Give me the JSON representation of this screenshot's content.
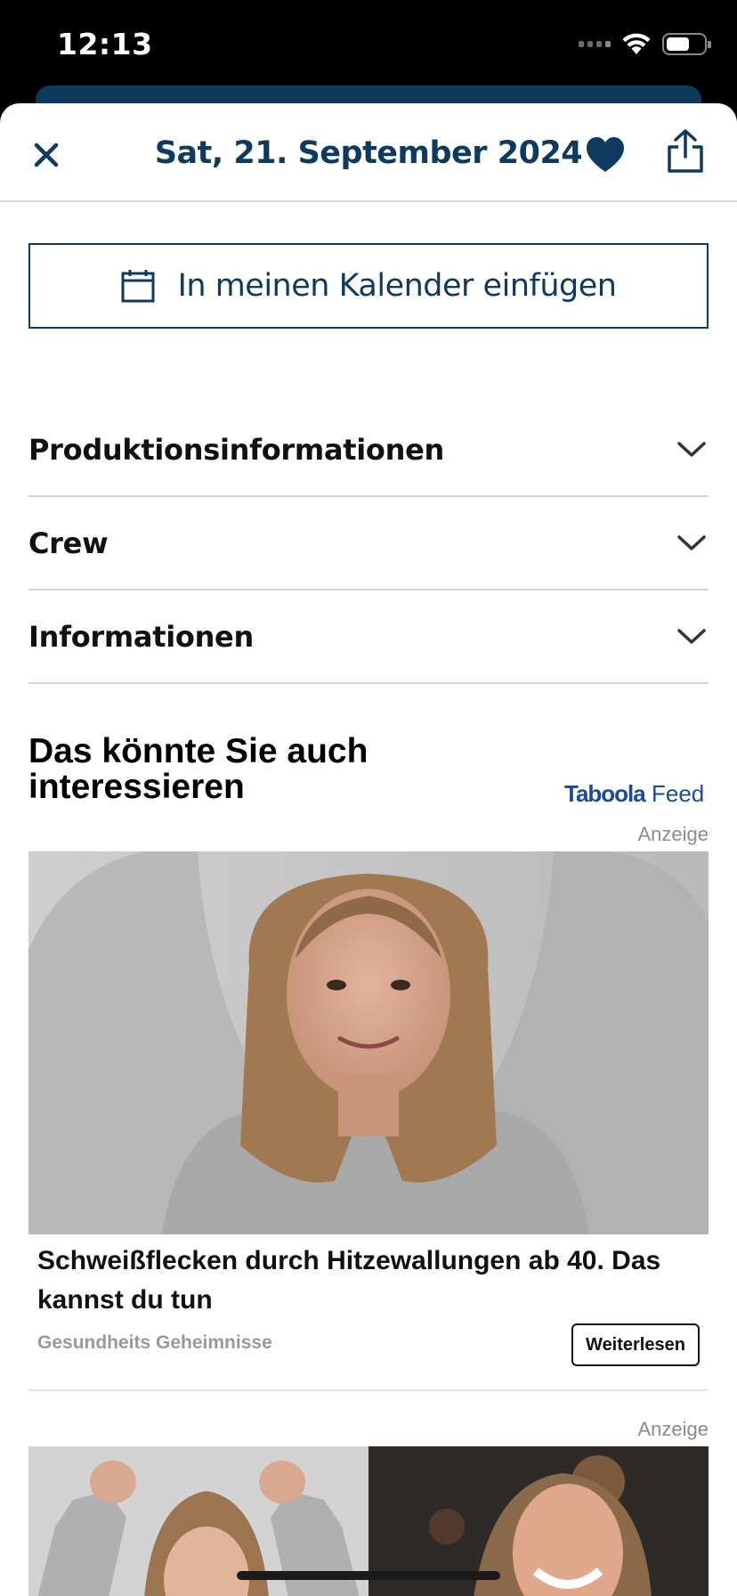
{
  "status": {
    "time": "12:13"
  },
  "header": {
    "title": "Sat, 21. September 2024"
  },
  "calendar_button": {
    "label": "In meinen Kalender einfügen"
  },
  "accordion": [
    {
      "label": "Produktionsinformationen"
    },
    {
      "label": "Crew"
    },
    {
      "label": "Informationen"
    }
  ],
  "recommendations": {
    "title": "Das könnte Sie auch interessieren",
    "provider_brand": "Taboola",
    "provider_suffix": "Feed",
    "sponsored_label": "Anzeige",
    "items": [
      {
        "title": "Schweißflecken durch Hitzewallungen ab 40. Das kannst du tun",
        "source": "Gesundheits Geheimnisse",
        "cta": "Weiterlesen"
      }
    ],
    "second_sponsored_label": "Anzeige"
  },
  "colors": {
    "brand": "#0f3a5f",
    "muted": "#8c8c8c",
    "divider": "#d4d4d4"
  }
}
